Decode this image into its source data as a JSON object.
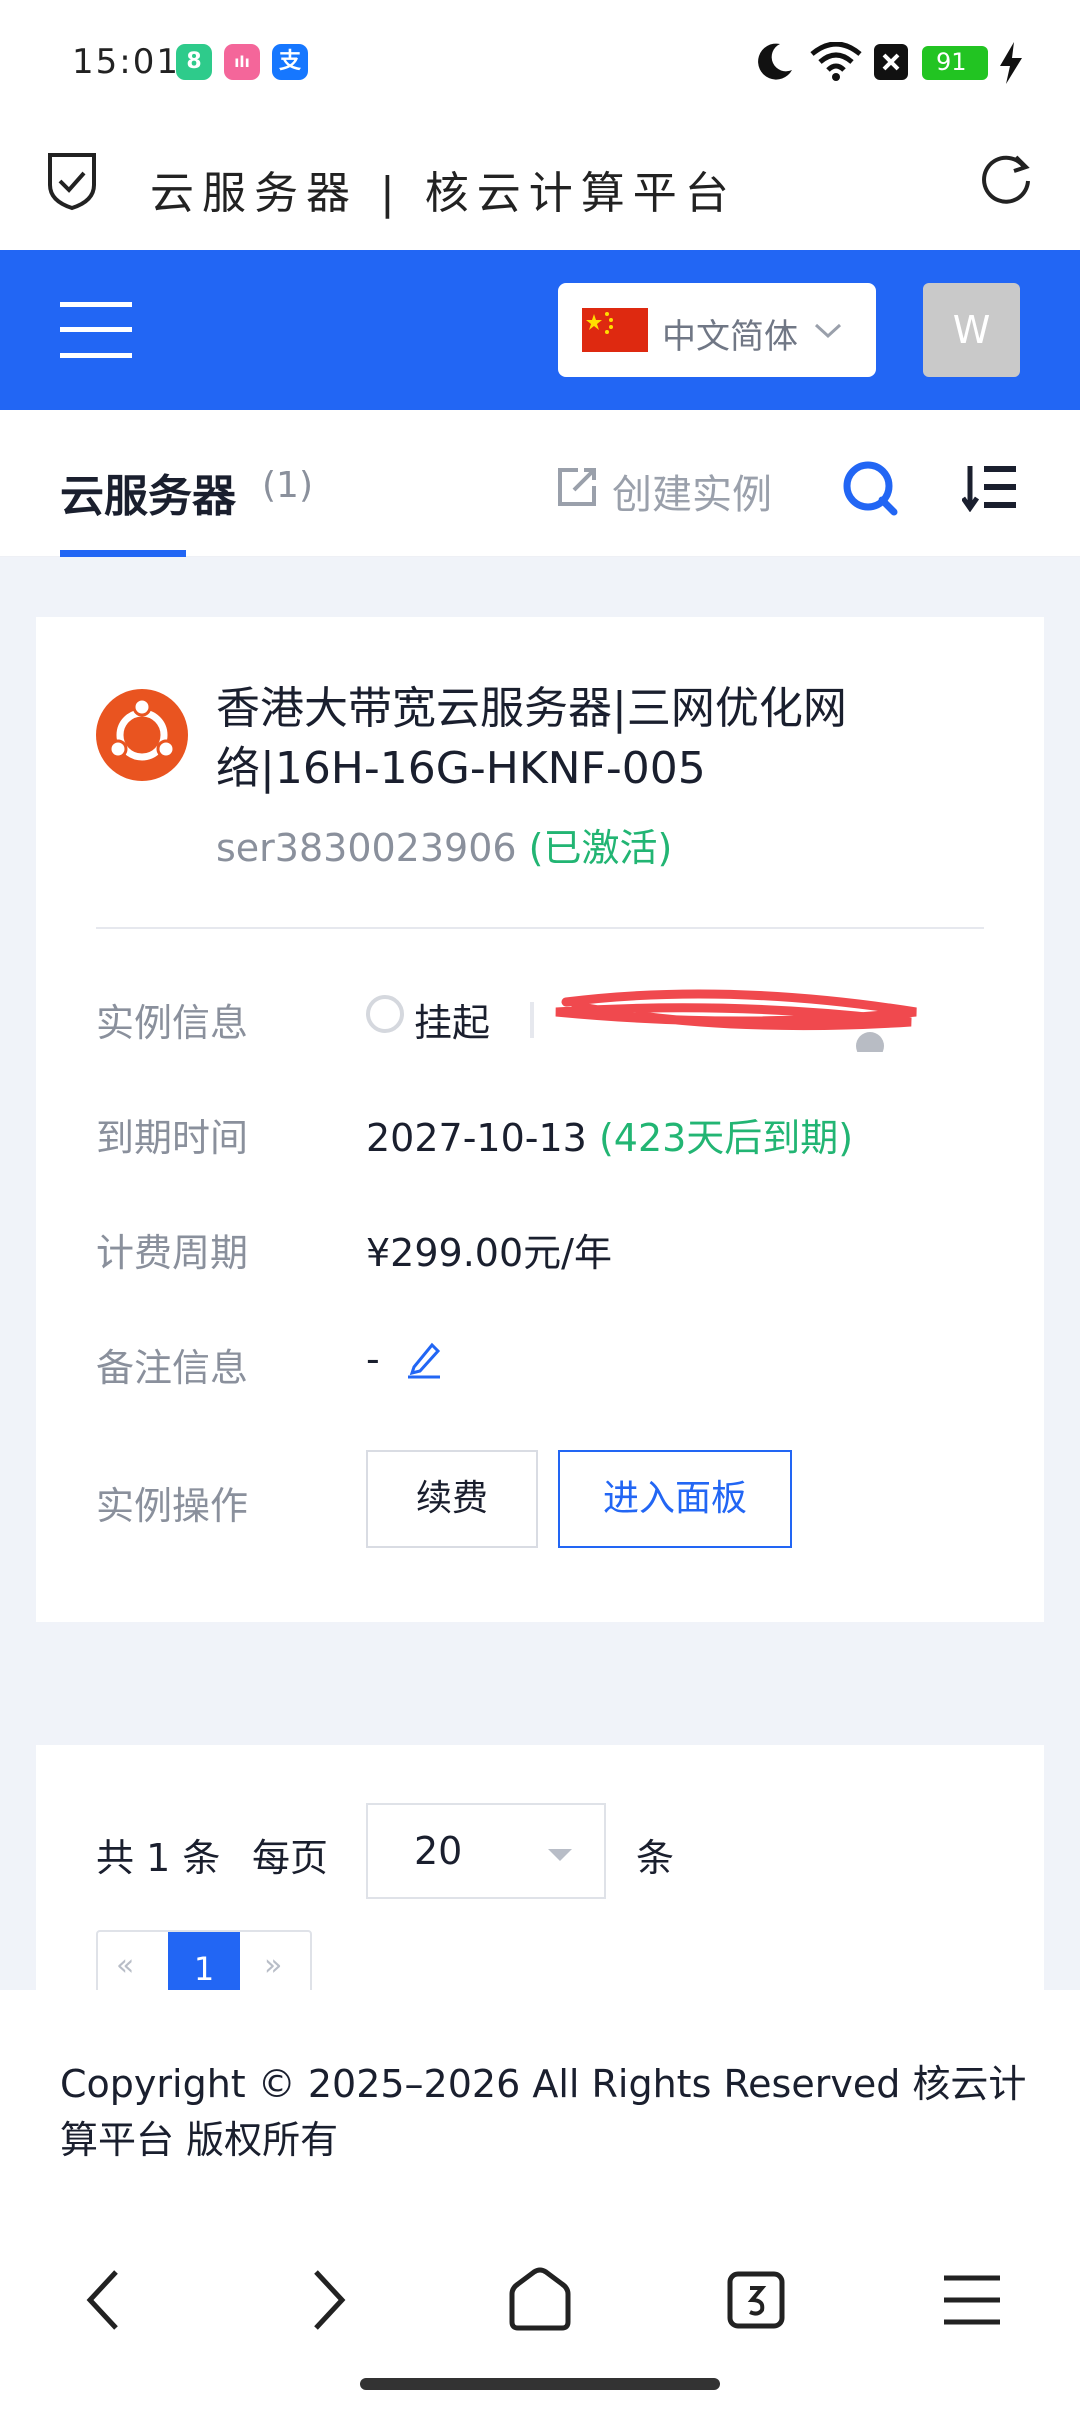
{
  "status_bar": {
    "time": "15:01",
    "battery": "91",
    "apps": [
      {
        "name": "calculator-app-icon",
        "glyph": "8",
        "color": "#2ecb8b"
      },
      {
        "name": "bilibili-app-icon",
        "glyph": "ılı",
        "color": "#f4669a"
      },
      {
        "name": "alipay-app-icon",
        "glyph": "支",
        "color": "#1677ff"
      }
    ]
  },
  "browser": {
    "title": "云服务器 | 核云计算平台"
  },
  "header": {
    "language": "中文简体",
    "avatar_initial": "W",
    "brand_color": "#2266f4"
  },
  "tab": {
    "title": "云服务器",
    "count": "(1)",
    "create_label": "创建实例"
  },
  "server": {
    "name": "香港大带宽云服务器|三网优化网络|16H-16G-HKNF-005",
    "id": "ser3830023906",
    "status": "(已激活)",
    "rows": {
      "instance_info": {
        "label": "实例信息",
        "value": "挂起"
      },
      "expiry": {
        "label": "到期时间",
        "value": "2027-10-13",
        "note": "(423天后到期)"
      },
      "billing": {
        "label": "计费周期",
        "value": "¥299.00元/年"
      },
      "remark": {
        "label": "备注信息",
        "value": "-"
      },
      "actions": {
        "label": "实例操作",
        "renew": "续费",
        "panel": "进入面板"
      }
    }
  },
  "pagination": {
    "total": "共 1 条",
    "per_page": "每页",
    "page_size": "20",
    "unit": "条",
    "prev": "«",
    "current": "1",
    "next": "»"
  },
  "footer": {
    "copyright": "Copyright © 2025–2026 All Rights Reserved 核云计算平台 版权所有"
  }
}
